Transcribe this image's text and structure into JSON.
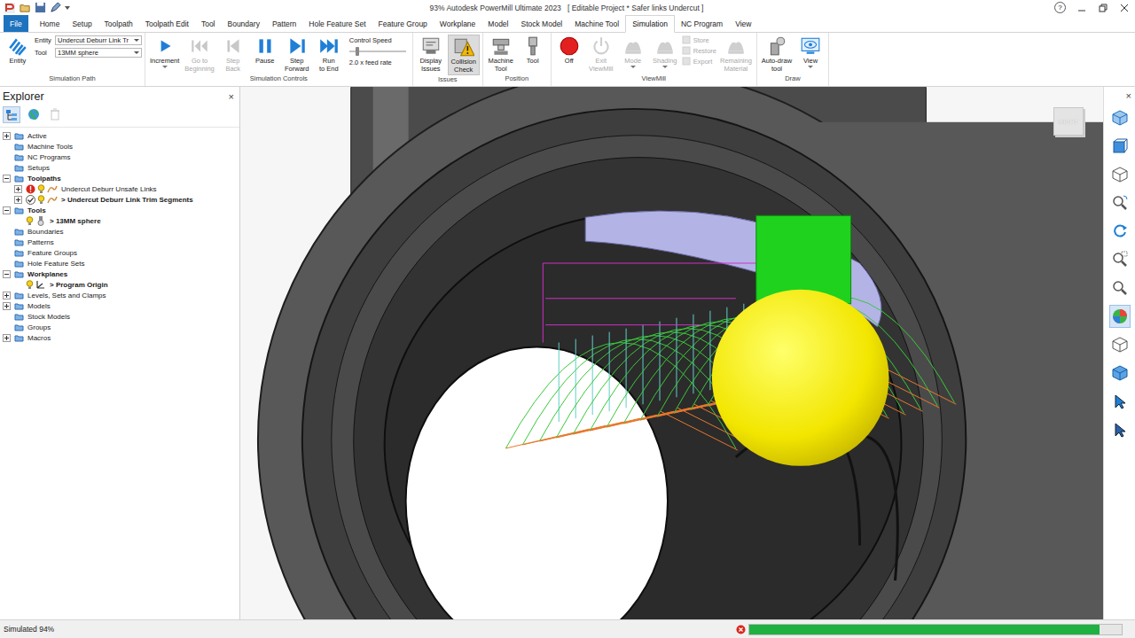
{
  "window": {
    "title": "93% Autodesk PowerMill Ultimate 2023   [ Editable Project * Safer links Undercut ]",
    "help": "?"
  },
  "menu_tabs": [
    {
      "label": "File",
      "kind": "file",
      "selected": false
    },
    {
      "label": "Home",
      "kind": "tab",
      "selected": false
    },
    {
      "label": "Setup",
      "kind": "tab",
      "selected": false
    },
    {
      "label": "Toolpath",
      "kind": "tab",
      "selected": false
    },
    {
      "label": "Toolpath Edit",
      "kind": "tab",
      "selected": false
    },
    {
      "label": "Tool",
      "kind": "tab",
      "selected": false
    },
    {
      "label": "Boundary",
      "kind": "tab",
      "selected": false
    },
    {
      "label": "Pattern",
      "kind": "tab",
      "selected": false
    },
    {
      "label": "Hole Feature Set",
      "kind": "tab",
      "selected": false
    },
    {
      "label": "Feature Group",
      "kind": "tab",
      "selected": false
    },
    {
      "label": "Workplane",
      "kind": "tab",
      "selected": false
    },
    {
      "label": "Model",
      "kind": "tab",
      "selected": false
    },
    {
      "label": "Stock Model",
      "kind": "tab",
      "selected": false
    },
    {
      "label": "Machine Tool",
      "kind": "tab",
      "selected": false
    },
    {
      "label": "Simulation",
      "kind": "tab",
      "selected": true
    },
    {
      "label": "NC Program",
      "kind": "tab",
      "selected": false
    },
    {
      "label": "View",
      "kind": "tab",
      "selected": false
    }
  ],
  "ribbon_groups": [
    {
      "label": "Simulation Path",
      "items": [
        {
          "kind": "entity",
          "label": "Entity",
          "disabled": false,
          "selected": false,
          "dropdown": false
        },
        {
          "kind": "fields",
          "fields": [
            {
              "label": "Entity",
              "value": "Undercut Deburr Link Tr"
            },
            {
              "label": "Tool",
              "value": "13MM sphere"
            }
          ]
        }
      ]
    },
    {
      "label": "Simulation Controls",
      "items": [
        {
          "kind": "increment",
          "label": "Increment",
          "disabled": false,
          "selected": false,
          "dropdown": true
        },
        {
          "kind": "first",
          "label": "Go to\nBeginning",
          "disabled": true,
          "selected": false,
          "dropdown": false
        },
        {
          "kind": "back",
          "label": "Step\nBack",
          "disabled": true,
          "selected": false,
          "dropdown": false
        },
        {
          "kind": "pause",
          "label": "Pause",
          "disabled": false,
          "selected": false,
          "dropdown": false
        },
        {
          "kind": "forward",
          "label": "Step\nForward",
          "disabled": false,
          "selected": false,
          "dropdown": false
        },
        {
          "kind": "last",
          "label": "Run\nto End",
          "disabled": false,
          "selected": false,
          "dropdown": false
        },
        {
          "kind": "speed",
          "label": "Control Speed",
          "level": 0.12,
          "reading": "2.0 x feed rate"
        }
      ]
    },
    {
      "label": "Issues",
      "items": [
        {
          "kind": "issues",
          "label": "Display\nIssues",
          "disabled": false,
          "selected": false,
          "dropdown": false
        },
        {
          "kind": "collision",
          "label": "Collision\nCheck",
          "disabled": false,
          "selected": true,
          "dropdown": false
        }
      ]
    },
    {
      "label": "Position",
      "items": [
        {
          "kind": "machine",
          "label": "Machine\nTool",
          "disabled": false,
          "selected": false,
          "dropdown": false
        },
        {
          "kind": "tool",
          "label": "Tool",
          "disabled": false,
          "selected": false,
          "dropdown": false
        }
      ]
    },
    {
      "label": "ViewMill",
      "items": [
        {
          "kind": "off",
          "label": "Off",
          "disabled": false,
          "selected": false,
          "dropdown": false
        },
        {
          "kind": "exit",
          "label": "Exit\nViewMill",
          "disabled": true,
          "selected": false,
          "dropdown": false
        },
        {
          "kind": "mode",
          "label": "Mode",
          "disabled": true,
          "selected": false,
          "dropdown": true
        },
        {
          "kind": "shading",
          "label": "Shading",
          "disabled": true,
          "selected": false,
          "dropdown": true
        },
        {
          "kind": "stack",
          "items": [
            {
              "label": "Store",
              "disabled": true
            },
            {
              "label": "Restore",
              "disabled": true
            },
            {
              "label": "Export",
              "disabled": true
            }
          ]
        },
        {
          "kind": "material",
          "label": "Remaining\nMaterial",
          "disabled": true,
          "selected": false,
          "dropdown": false
        }
      ]
    },
    {
      "label": "Draw",
      "items": [
        {
          "kind": "autodraw",
          "label": "Auto-draw\ntool",
          "disabled": false,
          "selected": false,
          "dropdown": false
        },
        {
          "kind": "view",
          "label": "View",
          "disabled": false,
          "selected": false,
          "dropdown": true
        }
      ]
    }
  ],
  "explorer": {
    "title": "Explorer",
    "close": "×",
    "items": [
      {
        "label": "Active",
        "level": 0,
        "expandable": true,
        "expanded": false,
        "bold": false,
        "kind": "folder",
        "status": "none"
      },
      {
        "label": "Machine Tools",
        "level": 0,
        "expandable": false,
        "expanded": false,
        "bold": false,
        "kind": "folder",
        "status": "none"
      },
      {
        "label": "NC Programs",
        "level": 0,
        "expandable": false,
        "expanded": false,
        "bold": false,
        "kind": "folder",
        "status": "none"
      },
      {
        "label": "Setups",
        "level": 0,
        "expandable": false,
        "expanded": false,
        "bold": false,
        "kind": "folder",
        "status": "none"
      },
      {
        "label": "Toolpaths",
        "level": 0,
        "expandable": true,
        "expanded": true,
        "bold": true,
        "kind": "folder",
        "status": "none"
      },
      {
        "label": "Undercut Deburr Unsafe Links",
        "level": 1,
        "expandable": true,
        "expanded": false,
        "bold": false,
        "kind": "toolpath",
        "status": "error"
      },
      {
        "label": "> Undercut Deburr Link Trim Segments",
        "level": 1,
        "expandable": true,
        "expanded": false,
        "bold": true,
        "kind": "toolpath",
        "status": "ok"
      },
      {
        "label": "Tools",
        "level": 0,
        "expandable": true,
        "expanded": true,
        "bold": true,
        "kind": "folder",
        "status": "none"
      },
      {
        "label": "> 13MM sphere",
        "level": 1,
        "expandable": false,
        "expanded": false,
        "bold": true,
        "kind": "tool",
        "status": "none"
      },
      {
        "label": "Boundaries",
        "level": 0,
        "expandable": false,
        "expanded": false,
        "bold": false,
        "kind": "folder",
        "status": "none"
      },
      {
        "label": "Patterns",
        "level": 0,
        "expandable": false,
        "expanded": false,
        "bold": false,
        "kind": "folder",
        "status": "none"
      },
      {
        "label": "Feature Groups",
        "level": 0,
        "expandable": false,
        "expanded": false,
        "bold": false,
        "kind": "folder",
        "status": "none"
      },
      {
        "label": "Hole Feature Sets",
        "level": 0,
        "expandable": false,
        "expanded": false,
        "bold": false,
        "kind": "folder",
        "status": "none"
      },
      {
        "label": "Workplanes",
        "level": 0,
        "expandable": true,
        "expanded": true,
        "bold": true,
        "kind": "folder",
        "status": "none"
      },
      {
        "label": "> Program Origin",
        "level": 1,
        "expandable": false,
        "expanded": false,
        "bold": true,
        "kind": "workplane",
        "status": "none"
      },
      {
        "label": "Levels, Sets and Clamps",
        "level": 0,
        "expandable": true,
        "expanded": false,
        "bold": false,
        "kind": "folder",
        "status": "none"
      },
      {
        "label": "Models",
        "level": 0,
        "expandable": true,
        "expanded": false,
        "bold": false,
        "kind": "folder",
        "status": "none"
      },
      {
        "label": "Stock Models",
        "level": 0,
        "expandable": false,
        "expanded": false,
        "bold": false,
        "kind": "folder",
        "status": "none"
      },
      {
        "label": "Groups",
        "level": 0,
        "expandable": false,
        "expanded": false,
        "bold": false,
        "kind": "folder",
        "status": "none"
      },
      {
        "label": "Macros",
        "level": 0,
        "expandable": true,
        "expanded": false,
        "bold": false,
        "kind": "folder",
        "status": "none"
      }
    ]
  },
  "viewport": {
    "view_cube": "RIGHT"
  },
  "view_toolbar": {
    "close": "×",
    "items": [
      {
        "kind": "iso",
        "selected": false
      },
      {
        "kind": "front",
        "selected": false
      },
      {
        "kind": "wire",
        "selected": false
      },
      {
        "kind": "zoom-rotate",
        "selected": false
      },
      {
        "kind": "refresh",
        "selected": false
      },
      {
        "kind": "zoom-box",
        "selected": false
      },
      {
        "kind": "zoom",
        "selected": false
      },
      {
        "kind": "shade",
        "selected": true
      },
      {
        "kind": "box",
        "selected": false
      },
      {
        "kind": "box-blue",
        "selected": false
      },
      {
        "kind": "select",
        "selected": false
      },
      {
        "kind": "pointer",
        "selected": false
      }
    ]
  },
  "status_bar": {
    "text": "Simulated 94%",
    "progress": {
      "level": 0.94
    }
  }
}
